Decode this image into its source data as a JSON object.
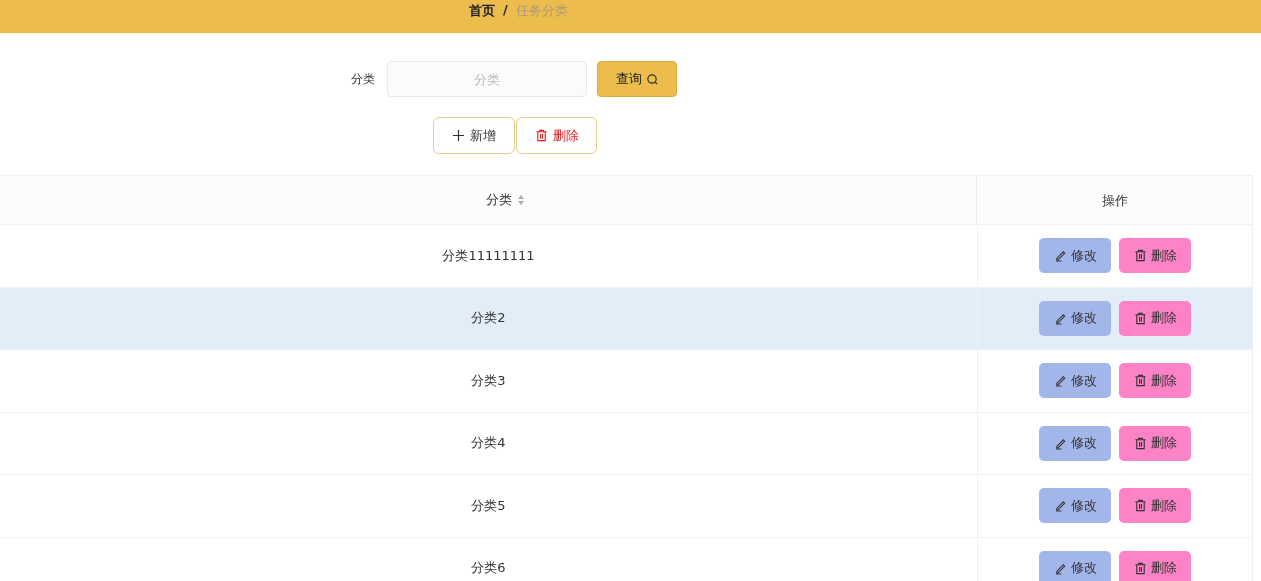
{
  "breadcrumb_separator": "/",
  "breadcrumb": [
    {
      "label": "首页",
      "current": false
    },
    {
      "label": "任务分类",
      "current": true
    }
  ],
  "search": {
    "label": "分类",
    "placeholder": "分类",
    "button": "查询"
  },
  "actions": [
    {
      "kind": "add",
      "label": "新增"
    },
    {
      "kind": "delete",
      "label": "删除"
    }
  ],
  "table": {
    "columns": [
      "分类",
      "操作"
    ],
    "rows": [
      {
        "name": "分类11111111",
        "hovered": false,
        "buttons": [
          "修改",
          "删除"
        ]
      },
      {
        "name": "分类2",
        "hovered": true,
        "buttons": [
          "修改",
          "删除"
        ]
      },
      {
        "name": "分类3",
        "hovered": false,
        "buttons": [
          "修改",
          "删除"
        ]
      },
      {
        "name": "分类4",
        "hovered": false,
        "buttons": [
          "修改",
          "删除"
        ]
      },
      {
        "name": "分类5",
        "hovered": false,
        "buttons": [
          "修改",
          "删除"
        ]
      },
      {
        "name": "分类6",
        "hovered": false,
        "buttons": [
          "修改",
          "删除"
        ]
      }
    ]
  }
}
